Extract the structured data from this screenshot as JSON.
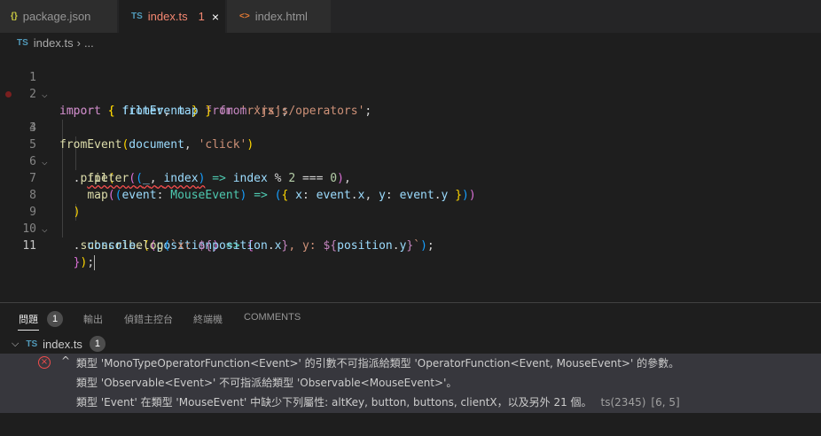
{
  "tabs": [
    {
      "icon": "{}",
      "label": "package.json"
    },
    {
      "icon": "TS",
      "label": "index.ts",
      "badge": "1",
      "close": "×"
    },
    {
      "icon": "<>",
      "label": "index.html"
    }
  ],
  "breadcrumb": {
    "icon": "TS",
    "file": "index.ts",
    "sep": "›",
    "rest": "..."
  },
  "editor": {
    "line_numbers": [
      "1",
      "2",
      "3",
      "4",
      "5",
      "6",
      "7",
      "8",
      "9",
      "10",
      "11"
    ]
  },
  "panel": {
    "tabs": [
      "問題",
      "輸出",
      "偵錯主控台",
      "終端機",
      "COMMENTS"
    ],
    "problem_count": "1",
    "file": {
      "icon": "TS",
      "name": "index.ts",
      "count": "1"
    },
    "error": {
      "line1": "類型 'MonoTypeOperatorFunction<Event>' 的引數不可指派給類型 'OperatorFunction<Event, MouseEvent>' 的參數。",
      "line2": "類型 'Observable<Event>' 不可指派給類型 'Observable<MouseEvent>'。",
      "line3": "類型 'Event' 在類型 'MouseEvent' 中缺少下列屬性: altKey, button, buttons, clientX，以及另外 21 個。",
      "code": "ts(2345)",
      "position": "[6, 5]"
    }
  }
}
